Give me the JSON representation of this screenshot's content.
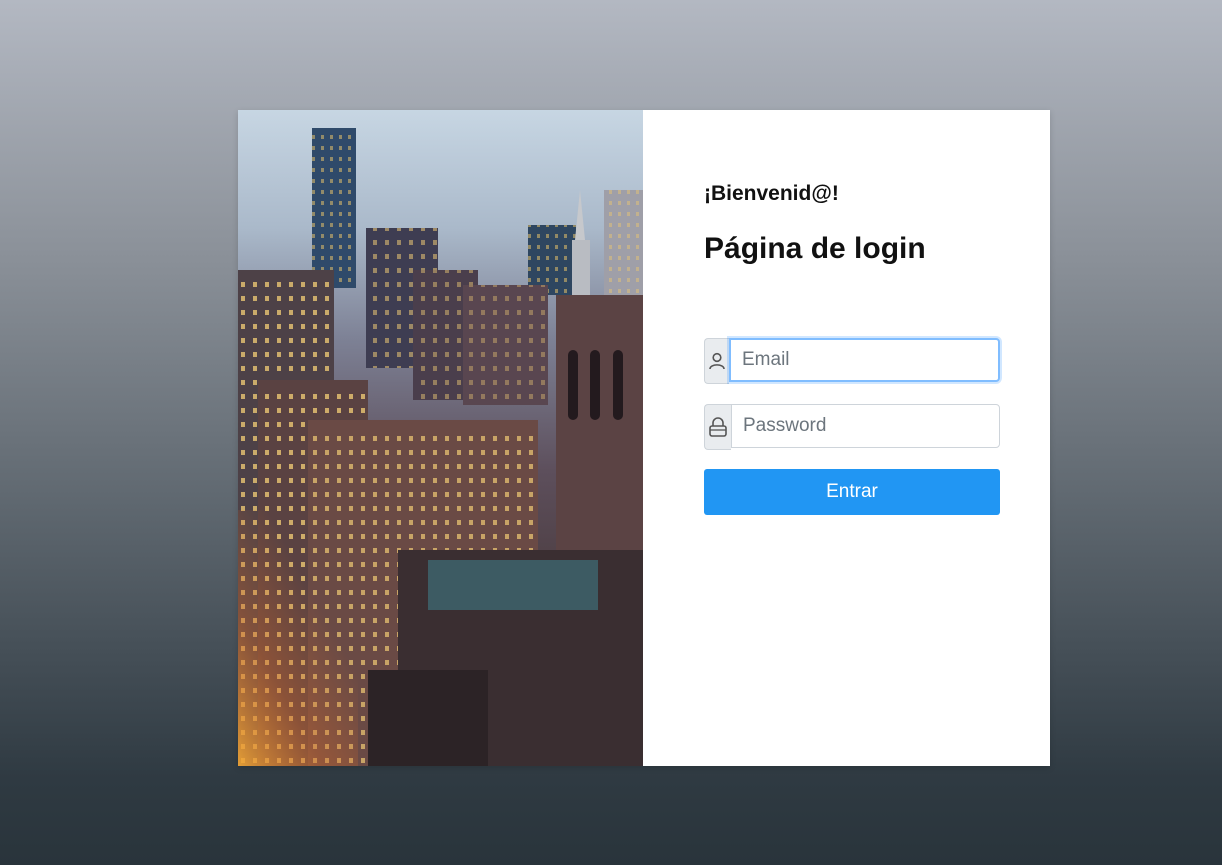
{
  "login": {
    "welcome": "¡Bienvenid@!",
    "title": "Página de login",
    "email_placeholder": "Email",
    "password_placeholder": "Password",
    "submit_label": "Entrar"
  },
  "icons": {
    "email": "user-icon",
    "password": "lock-icon"
  },
  "colors": {
    "primary": "#2196f3",
    "focus": "#80bdff"
  }
}
